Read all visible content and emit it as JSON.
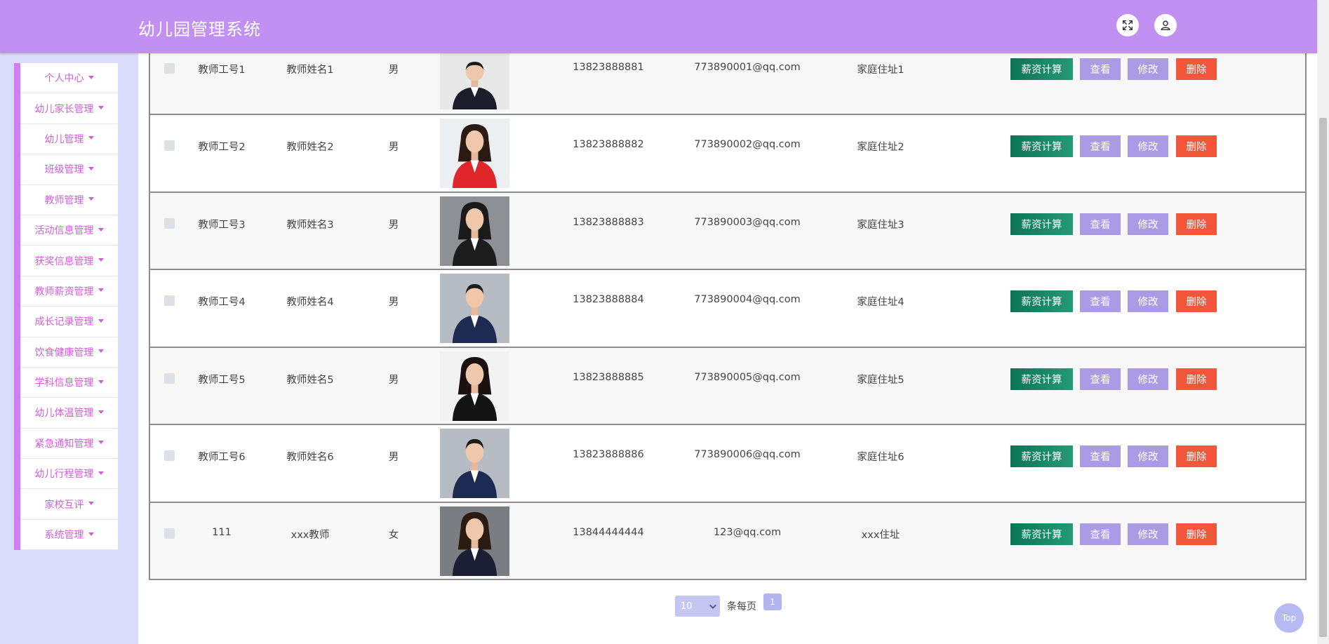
{
  "header": {
    "title": "幼儿园管理系统",
    "fullscreen_icon": "expand-arrows-icon",
    "user_icon": "user-icon"
  },
  "sidebar": {
    "items": [
      {
        "label": "个人中心"
      },
      {
        "label": "幼儿家长管理"
      },
      {
        "label": "幼儿管理"
      },
      {
        "label": "班级管理"
      },
      {
        "label": "教师管理"
      },
      {
        "label": "活动信息管理"
      },
      {
        "label": "获奖信息管理"
      },
      {
        "label": "教师薪资管理"
      },
      {
        "label": "成长记录管理"
      },
      {
        "label": "饮食健康管理"
      },
      {
        "label": "学科信息管理"
      },
      {
        "label": "幼儿体温管理"
      },
      {
        "label": "紧急通知管理"
      },
      {
        "label": "幼儿行程管理"
      },
      {
        "label": "家校互评"
      },
      {
        "label": "系统管理"
      }
    ]
  },
  "table": {
    "rows": [
      {
        "id": "教师工号1",
        "name": "教师姓名1",
        "gender": "男",
        "phone": "13823888881",
        "email": "773890001@qq.com",
        "address": "家庭住址1"
      },
      {
        "id": "教师工号2",
        "name": "教师姓名2",
        "gender": "男",
        "phone": "13823888882",
        "email": "773890002@qq.com",
        "address": "家庭住址2"
      },
      {
        "id": "教师工号3",
        "name": "教师姓名3",
        "gender": "男",
        "phone": "13823888883",
        "email": "773890003@qq.com",
        "address": "家庭住址3"
      },
      {
        "id": "教师工号4",
        "name": "教师姓名4",
        "gender": "男",
        "phone": "13823888884",
        "email": "773890004@qq.com",
        "address": "家庭住址4"
      },
      {
        "id": "教师工号5",
        "name": "教师姓名5",
        "gender": "男",
        "phone": "13823888885",
        "email": "773890005@qq.com",
        "address": "家庭住址5"
      },
      {
        "id": "教师工号6",
        "name": "教师姓名6",
        "gender": "男",
        "phone": "13823888886",
        "email": "773890006@qq.com",
        "address": "家庭住址6"
      },
      {
        "id": "111",
        "name": "xxx教师",
        "gender": "女",
        "phone": "13844444444",
        "email": "123@qq.com",
        "address": "xxx住址"
      }
    ],
    "actions": {
      "salary": "薪资计算",
      "view": "查看",
      "edit": "修改",
      "delete": "删除"
    }
  },
  "pagination": {
    "page_size": "10",
    "per_page_label": "条每页",
    "current_page": "1"
  },
  "top_button": "Top",
  "colors": {
    "header": "#c190f2",
    "sidebar_bg": "#dbdcfd",
    "menu_text": "#cf5fd6",
    "salary_btn": "#0b7457",
    "view_btn": "#a99ce5",
    "delete_btn": "#f2573b"
  }
}
